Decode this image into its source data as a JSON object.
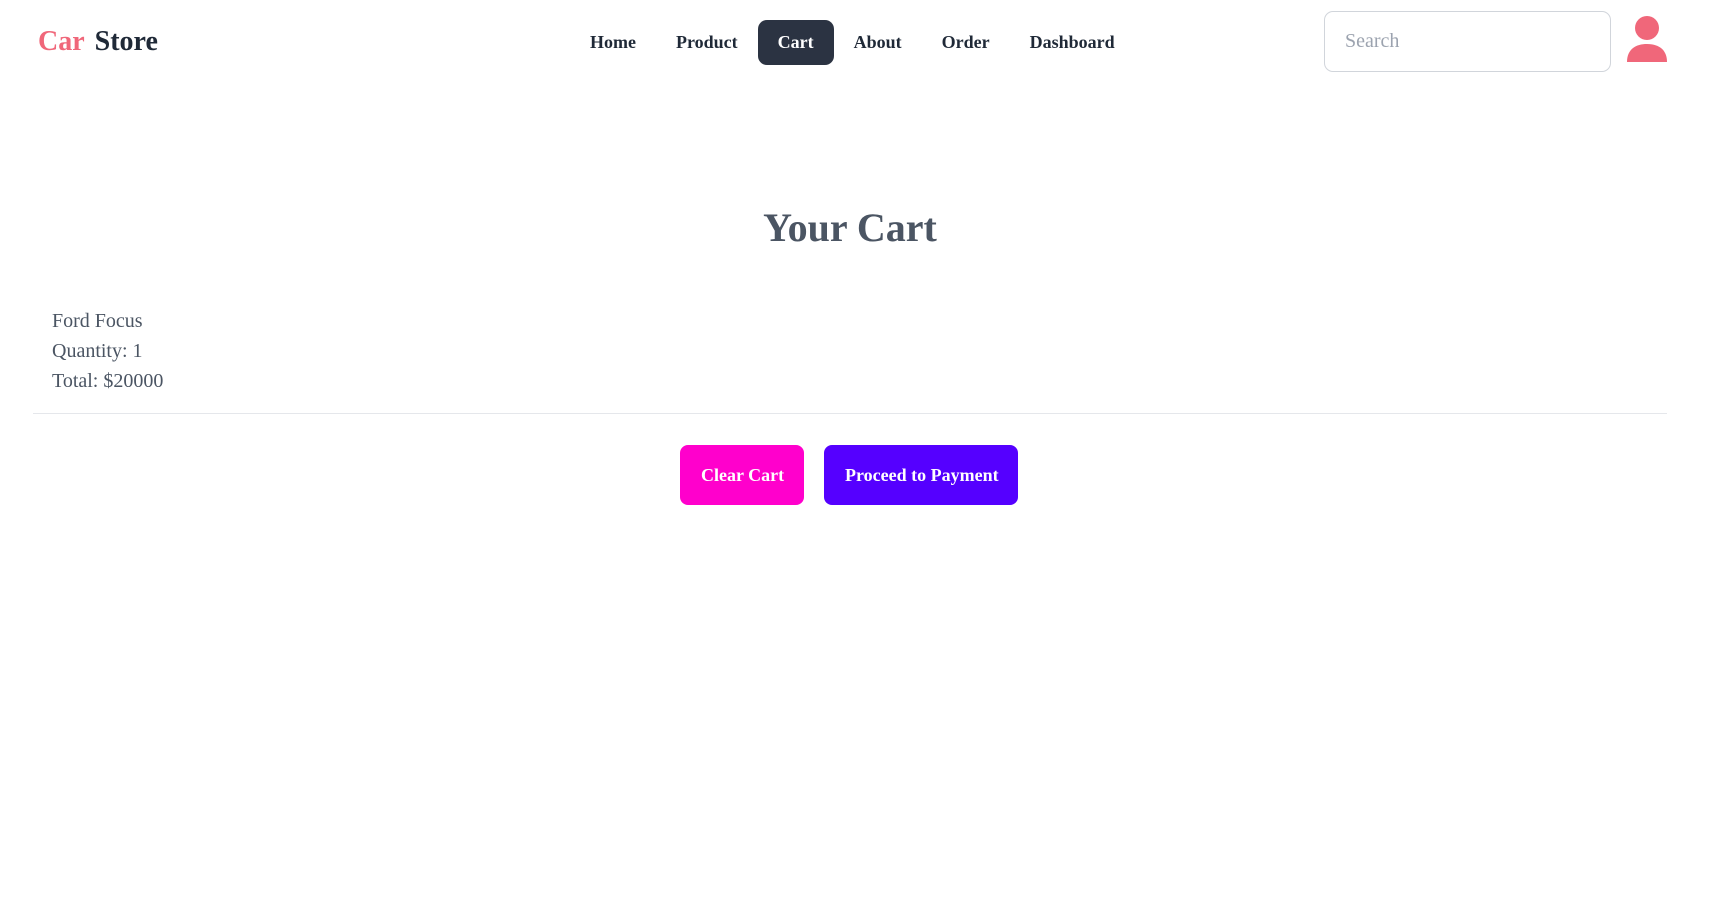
{
  "brand": {
    "part1": "Car",
    "part2": "Store"
  },
  "nav": {
    "items": [
      {
        "label": "Home",
        "active": false
      },
      {
        "label": "Product",
        "active": false
      },
      {
        "label": "Cart",
        "active": true
      },
      {
        "label": "About",
        "active": false
      },
      {
        "label": "Order",
        "active": false
      },
      {
        "label": "Dashboard",
        "active": false
      }
    ]
  },
  "search": {
    "placeholder": "Search",
    "value": ""
  },
  "avatar": {
    "icon": "user-icon",
    "color": "#f0677a"
  },
  "cart": {
    "title": "Your Cart",
    "items": [
      {
        "name": "Ford Focus",
        "quantity_text": "Quantity: 1",
        "total_text": "Total: $20000"
      }
    ],
    "clear_label": "Clear Cart",
    "pay_label": "Proceed to Payment"
  },
  "colors": {
    "brand_accent": "#f0677a",
    "nav_active_bg": "#2b3342",
    "clear_button": "#ff00cc",
    "pay_button": "#5500ff"
  }
}
